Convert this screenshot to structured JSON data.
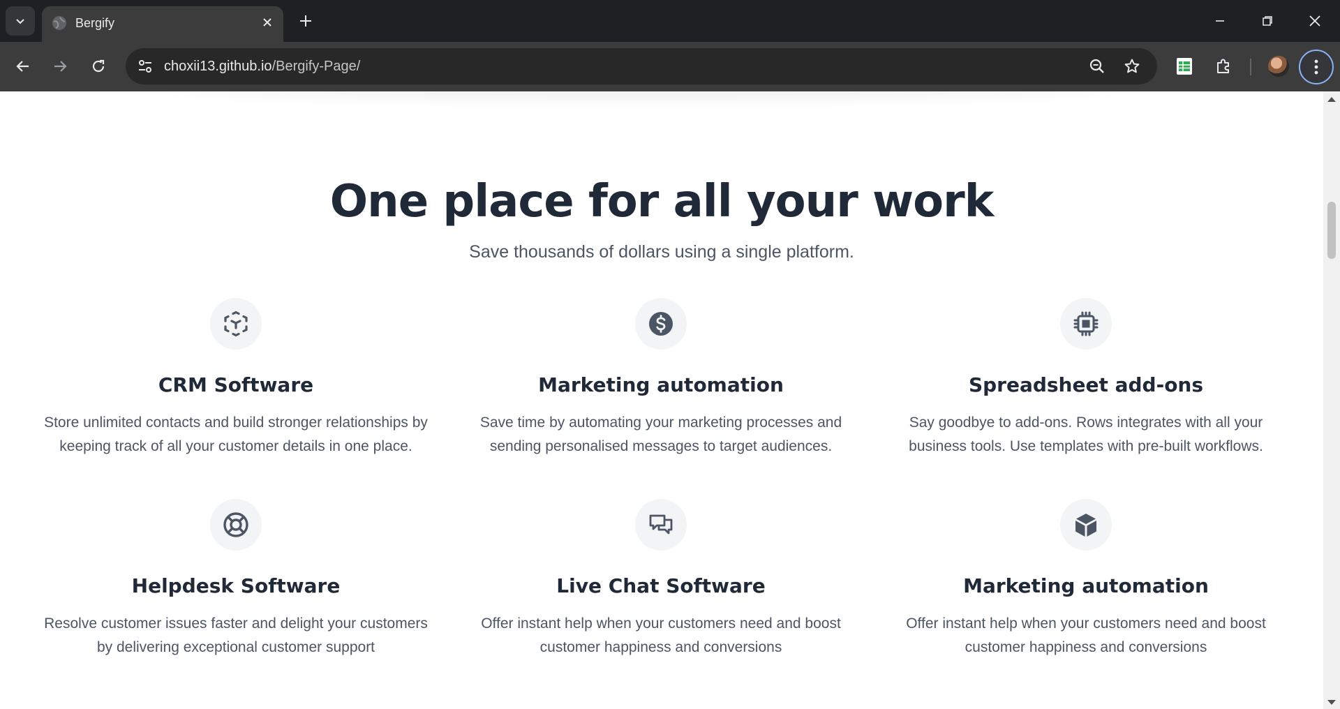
{
  "browser": {
    "tab_title": "Bergify",
    "url_host": "choxii13.github.io",
    "url_path": "/Bergify-Page/"
  },
  "section": {
    "title": "One place for all your work",
    "subtitle": "Save thousands of dollars using a single platform."
  },
  "features": [
    {
      "icon": "cube-scan-icon",
      "title": "CRM Software",
      "desc_line1": "Store unlimited contacts and build stronger relationships by",
      "desc_line2": "keeping track of all your customer details in one place."
    },
    {
      "icon": "dollar-circle-icon",
      "title": "Marketing automation",
      "desc_line1": "Save time by automating your marketing processes and",
      "desc_line2": "sending personalised messages to target audiences."
    },
    {
      "icon": "cpu-chip-icon",
      "title": "Spreadsheet add-ons",
      "desc_line1": "Say goodbye to add-ons. Rows integrates with all your",
      "desc_line2": "business tools. Use templates with pre-built workflows."
    },
    {
      "icon": "lifebuoy-icon",
      "title": "Helpdesk Software",
      "desc_line1": "Resolve customer issues faster and delight your customers",
      "desc_line2": "by delivering exceptional customer support"
    },
    {
      "icon": "chat-bubbles-icon",
      "title": "Live Chat Software",
      "desc_line1": "Offer instant help when your customers need and boost",
      "desc_line2": "customer happiness and conversions"
    },
    {
      "icon": "box-icon",
      "title": "Marketing automation",
      "desc_line1": "Offer instant help when your customers need and boost",
      "desc_line2": "customer happiness and conversions"
    }
  ],
  "colors": {
    "heading": "#1f2937",
    "body_text": "#4b5563",
    "icon_bg": "#f3f4f6",
    "icon_fg": "#4b5563"
  }
}
